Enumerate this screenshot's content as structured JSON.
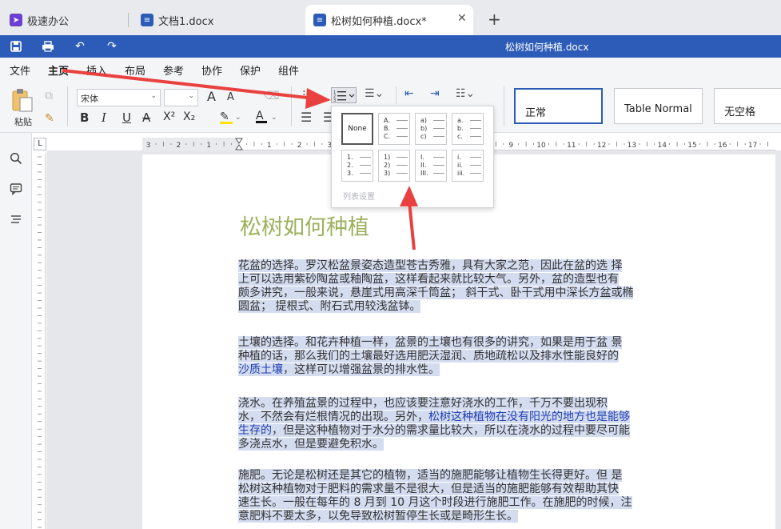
{
  "tabs": [
    {
      "label": "极速办公"
    },
    {
      "label": "文档1.docx"
    },
    {
      "label": "松树如何种植.docx*"
    }
  ],
  "title_bar": {
    "title": "松树如何种植.docx"
  },
  "menu": {
    "items": [
      "文件",
      "主页",
      "插入",
      "布局",
      "参考",
      "协作",
      "保护",
      "组件"
    ],
    "active": "主页"
  },
  "ribbon": {
    "paste_label": "粘贴",
    "font_name": "宋体",
    "font_size": "",
    "font_grow": "A",
    "font_shrink": "A",
    "bold": "B",
    "italic": "I",
    "underline": "U",
    "strike": "A",
    "superscript": "X²",
    "subscript": "X₂",
    "font_color": "A",
    "styles": [
      "正常",
      "Table Normal",
      "无空格"
    ]
  },
  "list_dropdown": {
    "options": [
      {
        "type": "none",
        "label": "None",
        "markers": []
      },
      {
        "type": "upper-alpha",
        "markers": [
          "A.",
          "B.",
          "C."
        ]
      },
      {
        "type": "lower-alpha-paren",
        "markers": [
          "a)",
          "b)",
          "c)"
        ]
      },
      {
        "type": "lower-alpha",
        "markers": [
          "a.",
          "b.",
          "c."
        ]
      },
      {
        "type": "decimal",
        "markers": [
          "1.",
          "2.",
          "3."
        ]
      },
      {
        "type": "decimal-paren",
        "markers": [
          "1)",
          "2)",
          "3)"
        ]
      },
      {
        "type": "upper-roman",
        "markers": [
          "I.",
          "II.",
          "III."
        ]
      },
      {
        "type": "lower-roman",
        "markers": [
          "i.",
          "ii.",
          "iii."
        ]
      }
    ],
    "footer": "列表设置"
  },
  "ruler": {
    "labels": [
      "3",
      "2",
      "1",
      "1",
      "2",
      "3",
      "4",
      "5",
      "6",
      "7",
      "8",
      "9",
      "10",
      "11",
      "12",
      "13",
      "14",
      "15",
      "16",
      "17"
    ]
  },
  "document": {
    "heading": "松树如何种植",
    "paragraphs": [
      {
        "lines": [
          [
            "花盆的选择。罗汉松盆景姿态造型苍古秀雅，具有大家之范，因此在盆的选 择"
          ],
          [
            "上可以选用紫砂陶盆或釉陶盆，这样看起来就比较大气。另外，盆的造型也有"
          ],
          [
            "颇多讲究，一般来说，悬崖式用高深千筒盆；  斜干式、卧干式用中深长方盆或椭"
          ],
          [
            "圆盆；  提根式、附石式用较浅盆钵。"
          ]
        ]
      },
      {
        "lines": [
          [
            "土壤的选择。和花卉种植一样，盆景的土壤也有很多的讲究，如果是用于盆 景"
          ],
          [
            "种植的话，那么我们的土壤最好选用肥沃湿润、质地疏松以及排水性能良好的"
          ],
          [
            "沙质土壤",
            "，这样可以增强盆景的排水性。"
          ]
        ]
      },
      {
        "lines": [
          [
            "浇水。在养殖盆景的过程中，也应该要注意好浇水的工作，千万不要出现积"
          ],
          [
            "水，不然会有烂根情况的出现。另外，",
            "松树这种植物在没有阳光的地方也是能够"
          ],
          [
            "生存的",
            "，但是这种植物对于水分的需求量比较大，所以在浇水的过程中要尽可能"
          ],
          [
            "多浇点水，但是要避免积水。"
          ]
        ]
      },
      {
        "lines": [
          [
            "施肥。无论是松树还是其它的植物，适当的施肥能够让植物生长得更好。但 是"
          ],
          [
            "松树这种植物对于肥料的需求量不是很大，但是适当的施肥能够有效帮助其快"
          ],
          [
            "速生长。一般在每年的 8 月到 10 月这个时段进行施肥工作。在施肥的时候，注"
          ],
          [
            "意肥料不要太多，以免导致松树暂停生长或是畸形生长。"
          ]
        ]
      }
    ]
  },
  "colors": {
    "accent": "#2c5cb8",
    "heading": "#9bb25c",
    "annotation": "#e8413f",
    "selection": "#d4dcf0",
    "link": "#1f3fb5"
  }
}
